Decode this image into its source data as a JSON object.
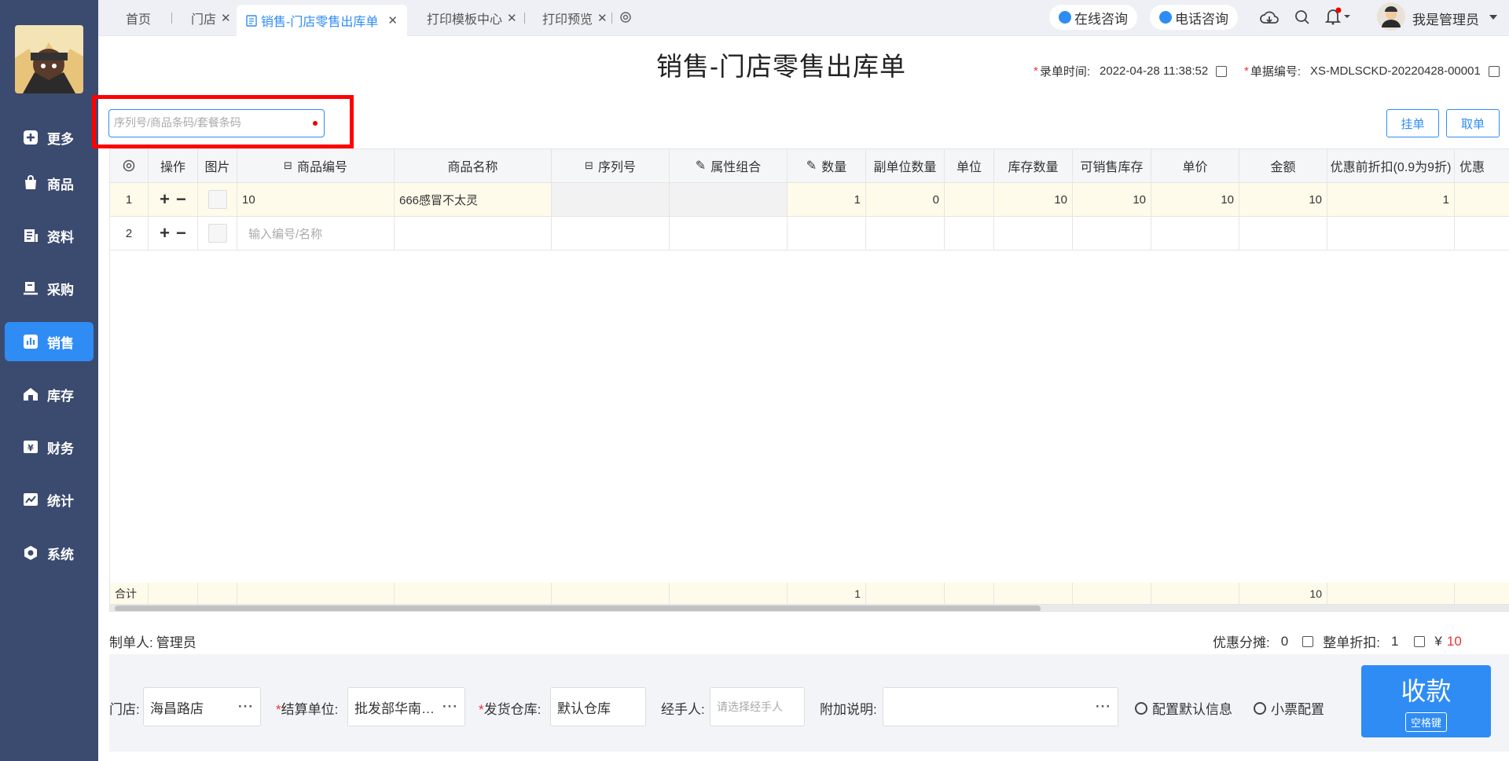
{
  "sidebar": {
    "items": [
      {
        "label": "更多",
        "icon": "plus-box-icon"
      },
      {
        "label": "商品",
        "icon": "bag-icon"
      },
      {
        "label": "资料",
        "icon": "document-icon"
      },
      {
        "label": "采购",
        "icon": "cart-icon"
      },
      {
        "label": "销售",
        "icon": "bar-chart-icon",
        "active": true
      },
      {
        "label": "库存",
        "icon": "warehouse-icon"
      },
      {
        "label": "财务",
        "icon": "yen-icon"
      },
      {
        "label": "统计",
        "icon": "line-chart-icon"
      },
      {
        "label": "系统",
        "icon": "hexagon-gear-icon"
      }
    ]
  },
  "tabs": [
    {
      "label": "首页"
    },
    {
      "label": "门店"
    },
    {
      "label": "销售-门店零售出库单"
    },
    {
      "label": "打印模板中心"
    },
    {
      "label": "打印预览"
    }
  ],
  "topbar": {
    "online_consult": "在线咨询",
    "phone_consult": "电话咨询",
    "user": "我是管理员"
  },
  "page": {
    "title": "销售-门店零售出库单",
    "entry_time_label": "录单时间:",
    "entry_time": "2022-04-28 11:38:52",
    "doc_no_label": "单据编号:",
    "doc_no": "XS-MDLSCKD-20220428-00001",
    "search_placeholder": "序列号/商品条码/套餐条码",
    "hold_button": "挂单",
    "retrieve_button": "取单"
  },
  "table": {
    "headers": [
      "操作",
      "图片",
      "商品编号",
      "商品名称",
      "序列号",
      "属性组合",
      "数量",
      "副单位数量",
      "单位",
      "库存数量",
      "可销售库存",
      "单价",
      "金额",
      "优惠前折扣(0.9为9折)",
      "优惠"
    ],
    "rows": [
      {
        "idx": "1",
        "code": "10",
        "name": "666感冒不太灵",
        "serial": "",
        "attr": "",
        "qty": "1",
        "sub_qty": "0",
        "unit": "",
        "stock": "10",
        "sellable": "10",
        "price": "10",
        "amount": "10",
        "discount": "1"
      },
      {
        "idx": "2",
        "code_placeholder": "输入编号/名称"
      }
    ],
    "total_label": "合计",
    "total_qty": "1",
    "total_amount": "10"
  },
  "footer": {
    "maker_label": "制单人:",
    "maker": "管理员",
    "discount_share_label": "优惠分摊:",
    "discount_share": "0",
    "whole_discount_label": "整单折扣:",
    "whole_discount": "1",
    "currency": "¥",
    "total": "10",
    "store_label": "门店:",
    "store": "海昌路店",
    "settle_label": "结算单位:",
    "settle": "批发部华南…",
    "warehouse_label": "发货仓库:",
    "warehouse": "默认仓库",
    "handler_label": "经手人:",
    "handler_placeholder": "请选择经手人",
    "note_label": "附加说明:",
    "config_default": "配置默认信息",
    "ticket_config": "小票配置",
    "pay_label": "收款",
    "pay_hint": "空格键"
  },
  "colors": {
    "accent": "#2f8cf4",
    "sidebar": "#3b4a6f",
    "highlight": "#ff0000",
    "required": "#e33333"
  }
}
